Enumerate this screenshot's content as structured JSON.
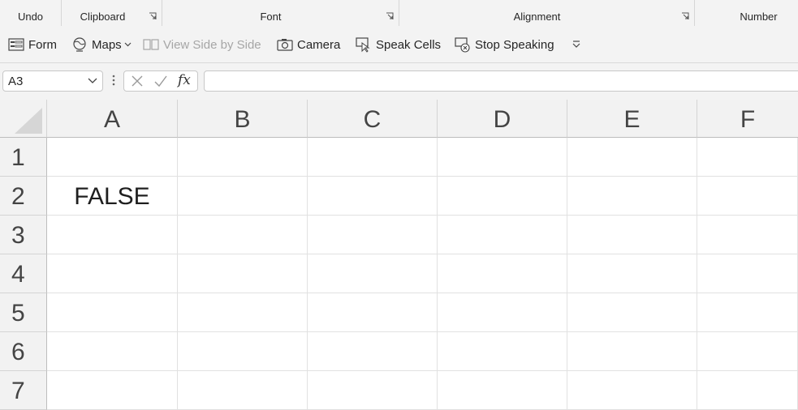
{
  "ribbon_groups": [
    {
      "label": "Undo"
    },
    {
      "label": "Clipboard"
    },
    {
      "label": "Font"
    },
    {
      "label": "Alignment"
    },
    {
      "label": "Number"
    }
  ],
  "qat": {
    "form": "Form",
    "maps": "Maps",
    "view_side_by_side": "View Side by Side",
    "camera": "Camera",
    "speak_cells": "Speak Cells",
    "stop_speaking": "Stop Speaking"
  },
  "formula_bar": {
    "name_box": "A3",
    "fx_label": "fx",
    "formula": ""
  },
  "sheet": {
    "columns": [
      "A",
      "B",
      "C",
      "D",
      "E",
      "F"
    ],
    "rows": [
      "1",
      "2",
      "3",
      "4",
      "5",
      "6",
      "7"
    ],
    "cells": {
      "A2": "FALSE"
    }
  }
}
